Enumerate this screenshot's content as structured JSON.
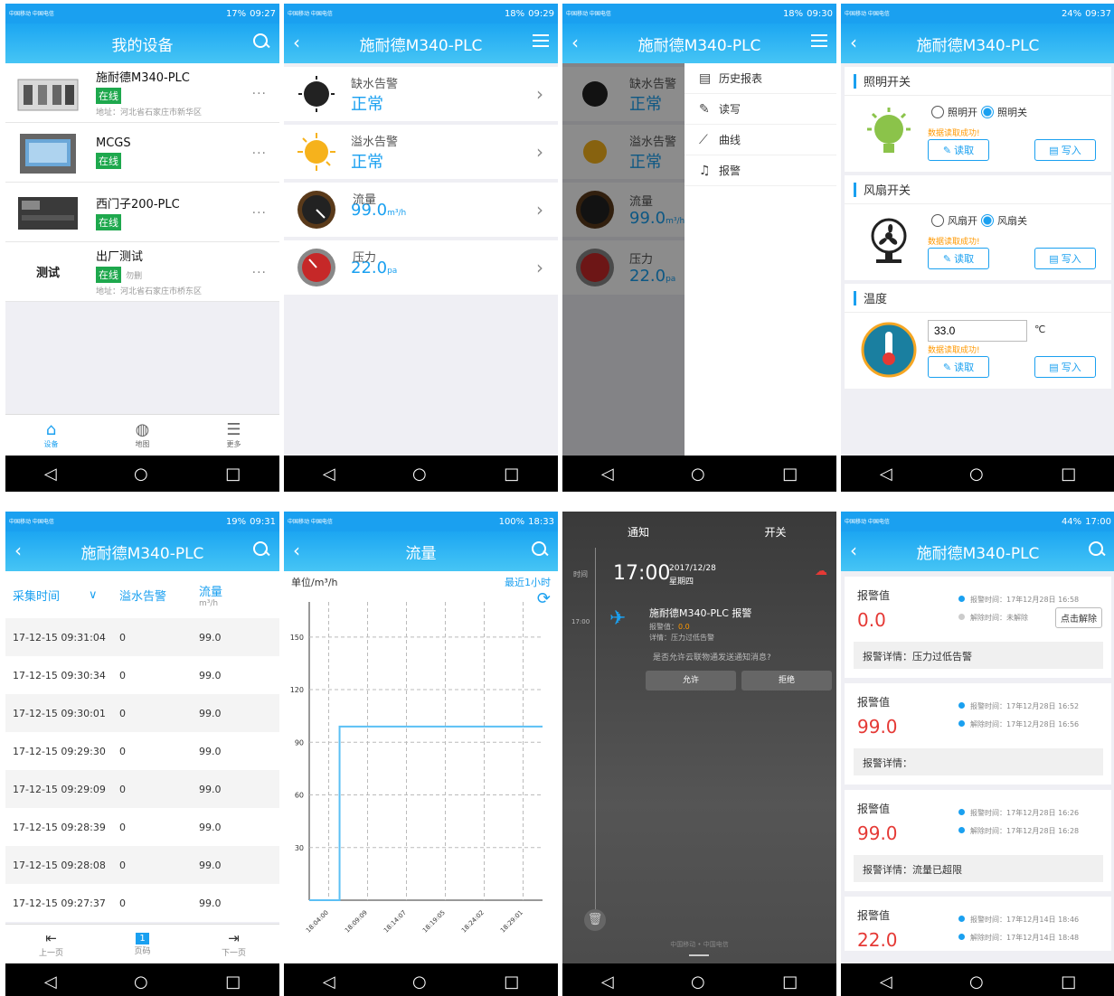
{
  "status": {
    "carrier": "中国移动 中国电信",
    "times": [
      "09:27",
      "09:29",
      "09:30",
      "09:37",
      "09:31",
      "18:33",
      "",
      "17:00"
    ],
    "batteries": [
      "17%",
      "18%",
      "18%",
      "24%",
      "19%",
      "100%",
      "",
      "44%"
    ]
  },
  "nav": {
    "back": "◁",
    "home": "○",
    "recent": "□"
  },
  "screen1": {
    "title": "我的设备",
    "devices": [
      {
        "name": "施耐德M340-PLC",
        "status": "在线",
        "addr": "地址：河北省石家庄市新华区"
      },
      {
        "name": "MCGS",
        "status": "在线",
        "addr": ""
      },
      {
        "name": "西门子200-PLC",
        "status": "在线",
        "addr": ""
      },
      {
        "name": "出厂测试",
        "status": "在线",
        "extra": "勿删",
        "addr": "地址：河北省石家庄市桥东区",
        "thumb": "测试"
      }
    ],
    "tabs": [
      {
        "label": "设备",
        "icon": "home-icon"
      },
      {
        "label": "地图",
        "icon": "globe-icon"
      },
      {
        "label": "更多",
        "icon": "list-icon"
      }
    ]
  },
  "device_title": "施耐德M340-PLC",
  "alarms": [
    {
      "label": "缺水告警",
      "value": "正常",
      "unit": ""
    },
    {
      "label": "溢水告警",
      "value": "正常",
      "unit": ""
    },
    {
      "label": "流量",
      "value": "99.0",
      "unit": "m³/h"
    },
    {
      "label": "压力",
      "value": "22.0",
      "unit": "pa"
    }
  ],
  "menu": [
    {
      "label": "历史报表",
      "icon": "report-icon"
    },
    {
      "label": "读写",
      "icon": "edit-icon"
    },
    {
      "label": "曲线",
      "icon": "curve-icon"
    },
    {
      "label": "报警",
      "icon": "bell-icon"
    }
  ],
  "screen4": {
    "light": {
      "title": "照明开关",
      "on": "照明开",
      "off": "照明关",
      "msg": "数据读取成功!"
    },
    "fan": {
      "title": "风扇开关",
      "on": "风扇开",
      "off": "风扇关",
      "msg": "数据读取成功!"
    },
    "temp": {
      "title": "温度",
      "value": "33.0",
      "unit": "℃",
      "msg": "数据读取成功!"
    },
    "read": "读取",
    "write": "写入"
  },
  "screen5": {
    "headers": [
      "采集时间",
      "溢水告警",
      "流量"
    ],
    "unit": "m³/h",
    "rows": [
      [
        "17-12-15 09:31:04",
        "0",
        "99.0"
      ],
      [
        "17-12-15 09:30:34",
        "0",
        "99.0"
      ],
      [
        "17-12-15 09:30:01",
        "0",
        "99.0"
      ],
      [
        "17-12-15 09:29:30",
        "0",
        "99.0"
      ],
      [
        "17-12-15 09:29:09",
        "0",
        "99.0"
      ],
      [
        "17-12-15 09:28:39",
        "0",
        "99.0"
      ],
      [
        "17-12-15 09:28:08",
        "0",
        "99.0"
      ],
      [
        "17-12-15 09:27:37",
        "0",
        "99.0"
      ]
    ],
    "pager": [
      "上一页",
      "页码",
      "下一页"
    ],
    "page": "1"
  },
  "screen6": {
    "title": "流量",
    "unit_label": "单位/m³/h",
    "range": "最近1小时"
  },
  "chart_data": {
    "type": "line",
    "ylim": [
      0,
      170
    ],
    "yticks": [
      30,
      60,
      90,
      120,
      150
    ],
    "x_labels": [
      "18:04:00",
      "18:09:09",
      "18:14:07",
      "18:19:05",
      "18:24:02",
      "18:29:01"
    ],
    "points": [
      [
        0,
        0
      ],
      [
        0.13,
        0
      ],
      [
        0.13,
        99
      ],
      [
        1,
        99
      ]
    ],
    "series_color": "#5bc0f5"
  },
  "screen7": {
    "tabs": [
      "通知",
      "开关"
    ],
    "time_label": "时间",
    "time": "17:00",
    "date": "2017/12/28",
    "weekday": "星期四",
    "side_time": "17:00",
    "title": "施耐德M340-PLC 报警",
    "value_label": "报警值：",
    "value": "0.0",
    "detail": "详情：压力过低告警",
    "question": "是否允许云联物通发送通知消息?",
    "allow": "允许",
    "deny": "拒绝",
    "footer": "中国移动 • 中国电信"
  },
  "screen8": {
    "label": "报警值",
    "time_prefix": "报警时间：",
    "clear_prefix": "解除时间：",
    "detail_prefix": "报警详情：",
    "unlock": "点击解除",
    "items": [
      {
        "value": "0.0",
        "time": "17年12月28日 16:58",
        "clear": "未解除",
        "detail": "压力过低告警"
      },
      {
        "value": "99.0",
        "time": "17年12月28日 16:52",
        "clear": "17年12月28日 16:56",
        "detail": ""
      },
      {
        "value": "99.0",
        "time": "17年12月28日 16:26",
        "clear": "17年12月28日 16:28",
        "detail": "流量已超限"
      },
      {
        "value": "22.0",
        "time": "17年12月14日 18:46",
        "clear": "17年12月14日 18:48",
        "detail": ""
      }
    ]
  },
  "colors": {
    "primary": "#1aa0f0",
    "online": "#1ea84d",
    "alarm": "#e53935",
    "ok": "#ff9800"
  }
}
